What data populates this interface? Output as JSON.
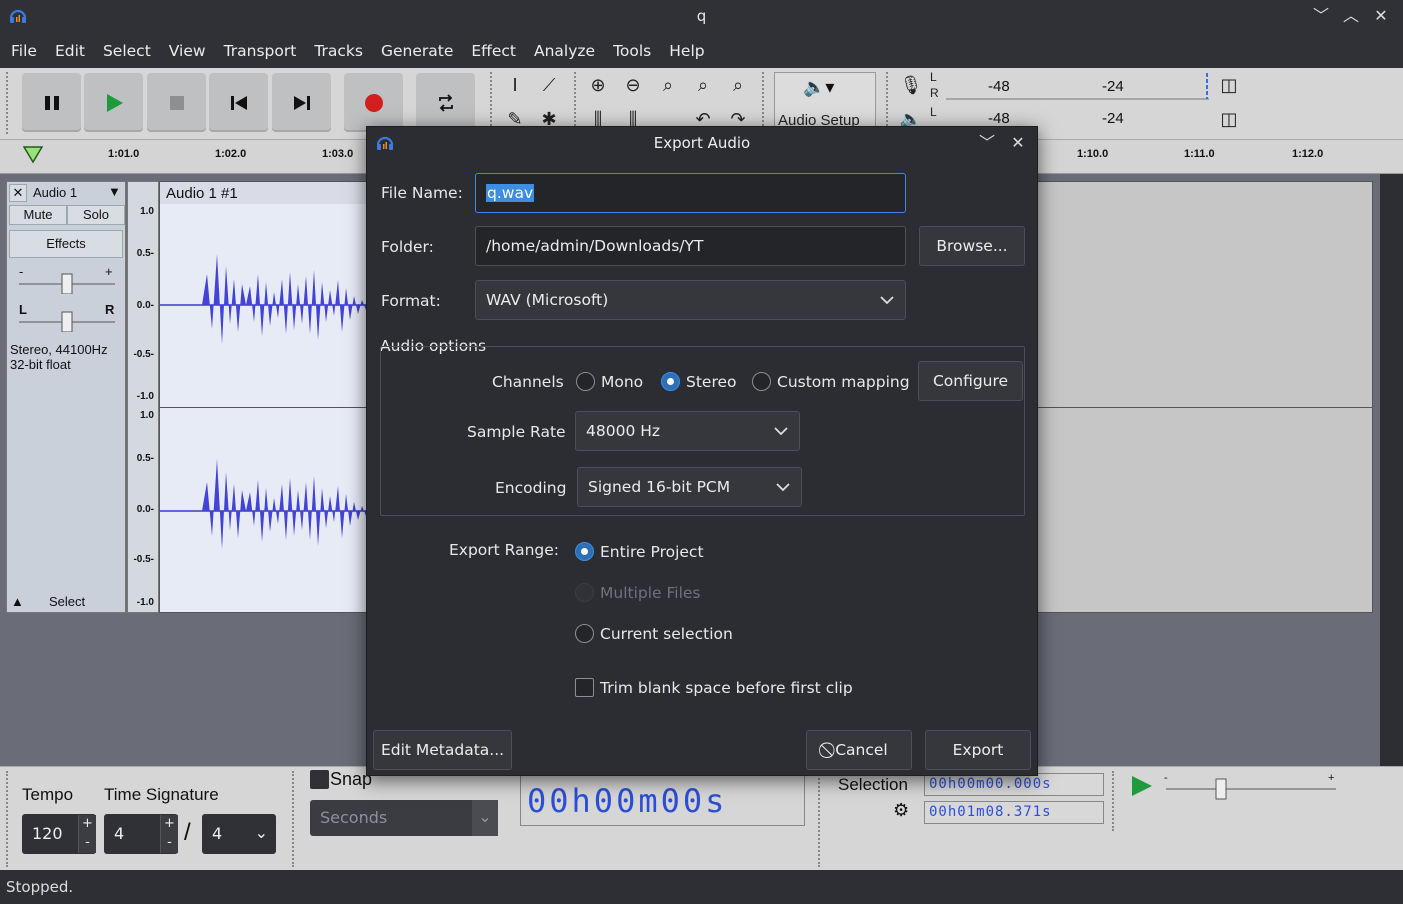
{
  "window": {
    "title": "q"
  },
  "menu": [
    "File",
    "Edit",
    "Select",
    "View",
    "Transport",
    "Tracks",
    "Generate",
    "Effect",
    "Analyze",
    "Tools",
    "Help"
  ],
  "toolbar": {
    "audio_setup_label": "Audio Setup",
    "meter_ticks": [
      "-48",
      "-24"
    ],
    "meter_top_channels": [
      "L",
      "R"
    ],
    "meter_bottom_channel": "L",
    "meter_partial": "-48"
  },
  "ruler": {
    "ticks_left": [
      "1:01.0",
      "1:02.0",
      "1:03.0"
    ],
    "ticks_right": [
      "1:10.0",
      "1:11.0",
      "1:12.0"
    ]
  },
  "track": {
    "name": "Audio 1",
    "close": "✕",
    "mute": "Mute",
    "solo": "Solo",
    "effects": "Effects",
    "gain_minus": "-",
    "gain_plus": "+",
    "pan_l": "L",
    "pan_r": "R",
    "info_line1": "Stereo, 44100Hz",
    "info_line2": "32-bit float",
    "select": "Select",
    "clip_name": "Audio 1 #1",
    "scale_top": [
      "1.0",
      "0.5-",
      "0.0-",
      "-0.5-",
      "-1.0"
    ],
    "scale_bottom": [
      "1.0",
      "0.5-",
      "0.0-",
      "-0.5-",
      "-1.0"
    ]
  },
  "bottom": {
    "tempo_label": "Tempo",
    "tempo_value": "120",
    "timesig_label": "Time Signature",
    "timesig_num": "4",
    "timesig_den": "4",
    "timesig_slash": "/",
    "snap_label": "Snap",
    "snap_unit": "Seconds",
    "time_display": "00h00m00s",
    "selection_label": "Selection",
    "sel_start": "00h00m00.000s",
    "sel_end": "00h01m08.371s"
  },
  "status": "Stopped.",
  "dialog": {
    "title": "Export Audio",
    "file_name_label": "File Name:",
    "file_name_value": "q.wav",
    "folder_label": "Folder:",
    "folder_value": "/home/admin/Downloads/YT",
    "browse": "Browse...",
    "format_label": "Format:",
    "format_value": "WAV (Microsoft)",
    "audio_options": "Audio options",
    "channels_label": "Channels",
    "mono": "Mono",
    "stereo": "Stereo",
    "custom_mapping": "Custom mapping",
    "configure": "Configure",
    "sample_rate_label": "Sample Rate",
    "sample_rate_value": "48000 Hz",
    "encoding_label": "Encoding",
    "encoding_value": "Signed 16-bit PCM",
    "export_range_label": "Export Range:",
    "entire_project": "Entire Project",
    "multiple_files": "Multiple Files",
    "current_selection": "Current selection",
    "trim_blank": "Trim blank space before first clip",
    "edit_metadata": "Edit Metadata...",
    "cancel": "Cancel",
    "export": "Export"
  }
}
